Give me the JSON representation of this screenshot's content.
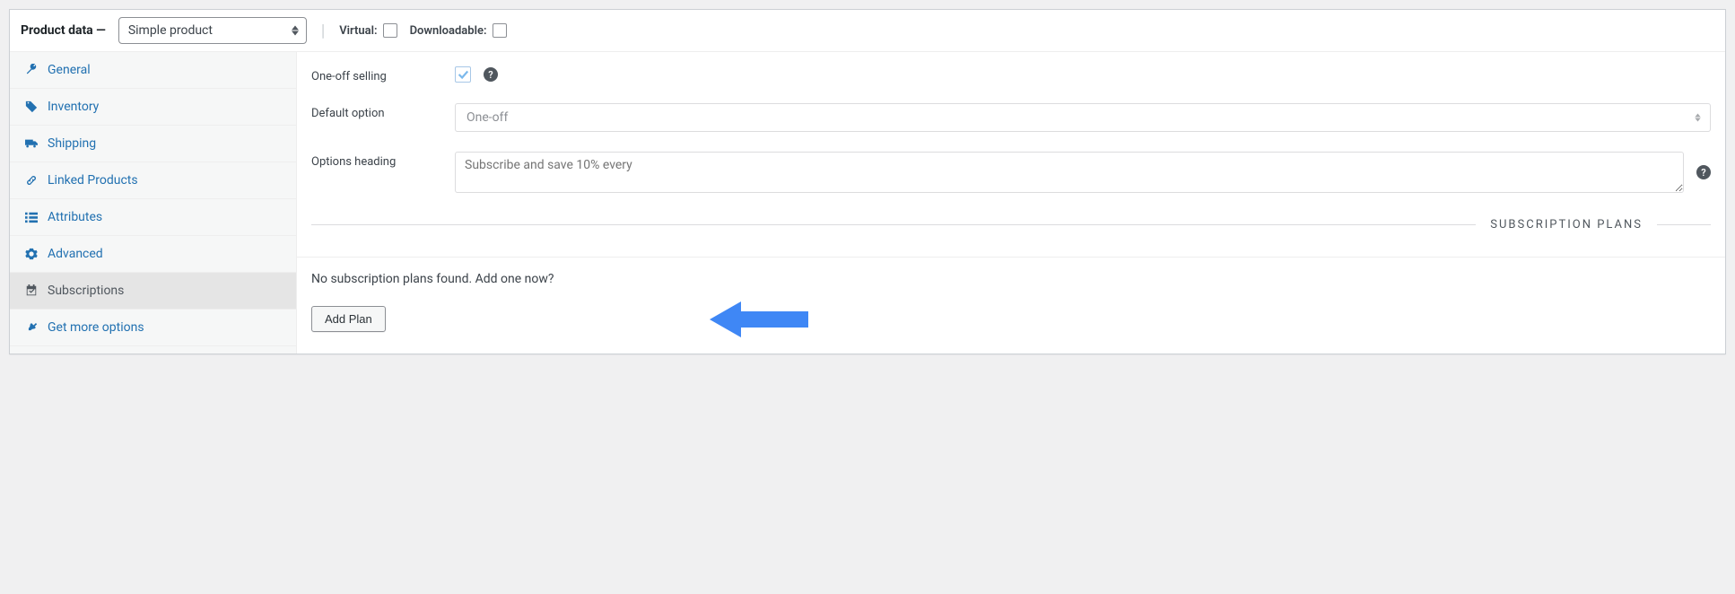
{
  "header": {
    "title_prefix": "Product data —",
    "product_type": "Simple product",
    "virtual_label": "Virtual:",
    "downloadable_label": "Downloadable:"
  },
  "tabs": {
    "general": "General",
    "inventory": "Inventory",
    "shipping": "Shipping",
    "linked": "Linked Products",
    "attributes": "Attributes",
    "advanced": "Advanced",
    "subscriptions": "Subscriptions",
    "getmore": "Get more options"
  },
  "form": {
    "oneoff_label": "One-off selling",
    "default_option_label": "Default option",
    "default_option_value": "One-off",
    "options_heading_label": "Options heading",
    "options_heading_placeholder": "Subscribe and save 10% every"
  },
  "section": {
    "plans_title": "SUBSCRIPTION PLANS",
    "empty_message": "No subscription plans found. Add one now?",
    "add_plan_label": "Add Plan"
  },
  "colors": {
    "link": "#2271b1",
    "arrow": "#3f87f5"
  }
}
